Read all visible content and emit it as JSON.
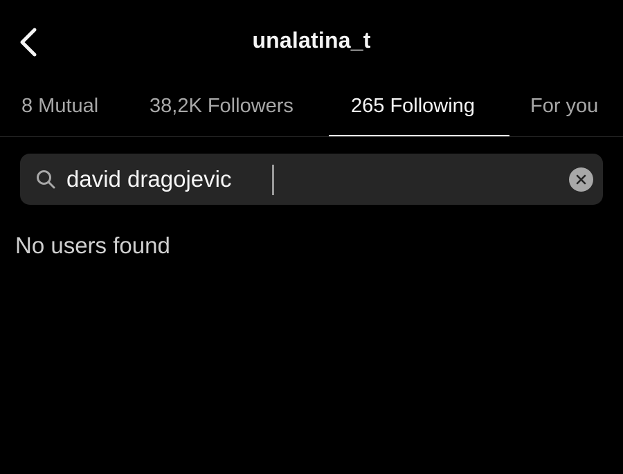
{
  "header": {
    "title": "unalatina_t",
    "back_icon": "chevron-left-icon"
  },
  "tabs": [
    {
      "label": "8 Mutual",
      "active": false
    },
    {
      "label": "38,2K Followers",
      "active": false
    },
    {
      "label": "265 Following",
      "active": true
    },
    {
      "label": "For you",
      "active": false
    }
  ],
  "search": {
    "value": "david dragojevic",
    "icon": "search-icon",
    "clear_icon": "clear-icon"
  },
  "results": {
    "empty_message": "No users found"
  },
  "colors": {
    "background": "#000000",
    "text_primary": "#f5f5f5",
    "text_secondary": "#a8a8a8",
    "search_background": "#262626"
  }
}
